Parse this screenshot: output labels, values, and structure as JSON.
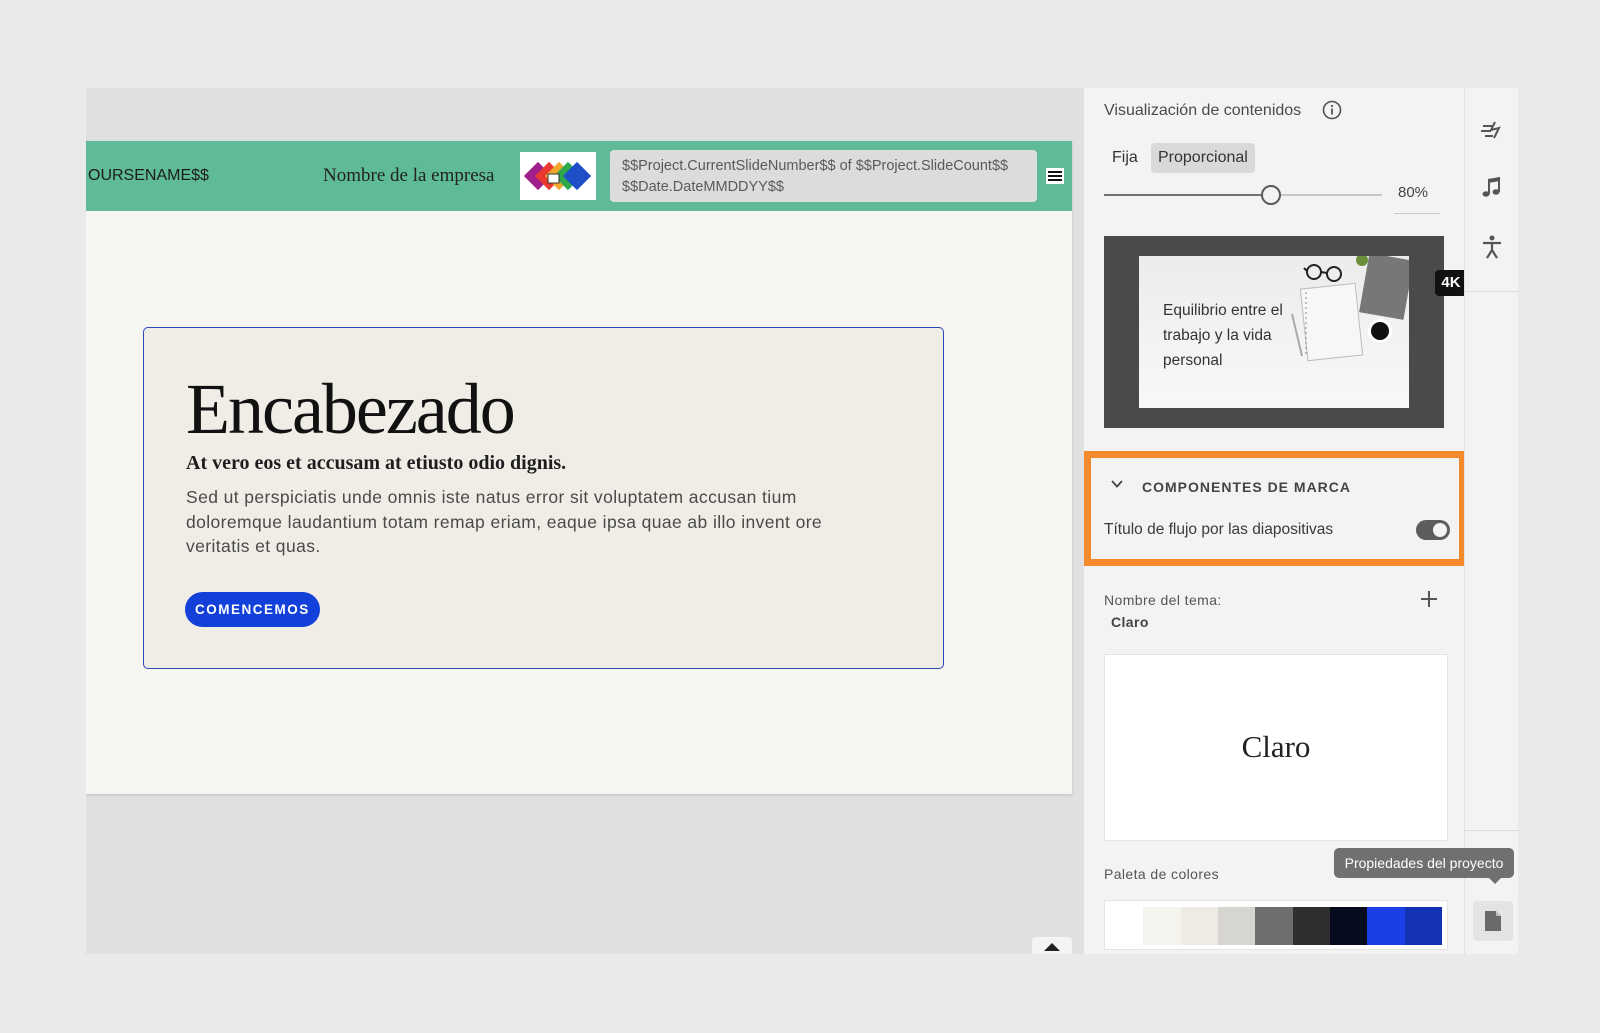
{
  "slide": {
    "header": {
      "course_name": "OURSENAME$$",
      "company_name": "Nombre de la empresa",
      "slide_info_line1": "$$Project.CurrentSlideNumber$$ of $$Project.SlideCount$$",
      "slide_info_line2": "$$Date.DateMMDDYY$$",
      "bar_color": "#5fbb97"
    },
    "card": {
      "title": "Encabezado",
      "subtitle": "At vero eos et accusam at etiusto odio dignis.",
      "body": "Sed ut perspiciatis unde omnis iste natus error sit voluptatem accusan tium doloremque laudantium totam remap eriam, eaque ipsa quae ab illo invent ore veritatis et quas.",
      "cta_label": "COMENCEMOS",
      "cta_color": "#1240d8"
    }
  },
  "panel": {
    "content_view": {
      "title": "Visualización de contenidos",
      "modes": [
        "Fija",
        "Proporcional"
      ],
      "selected_mode": "Proporcional",
      "zoom_label": "80%",
      "zoom_fraction": 0.6
    },
    "thumbnail": {
      "text": "Equilibrio entre el trabajo y la vida personal",
      "badge": "4K"
    },
    "brand_components": {
      "title": "COMPONENTES DE MARCA",
      "toggle_label": "Título de flujo por las diapositivas",
      "toggle_on": true,
      "highlight_color": "#f58a2c"
    },
    "theme": {
      "label": "Nombre del tema:",
      "value": "Claro",
      "preview_text": "Claro"
    },
    "palette": {
      "label": "Paleta de colores",
      "swatches": [
        "#ffffff",
        "#f5f3ee",
        "#eeebe2",
        "#d7d5d1",
        "#6e6e6e",
        "#2f2f2f",
        "#060c1e",
        "#1a3fe6",
        "#1333b4"
      ]
    }
  },
  "rail": {
    "icons": [
      "interactions-icon",
      "music-icon",
      "accessibility-icon",
      "document-icon"
    ],
    "tooltip": "Propiedades del proyecto"
  }
}
